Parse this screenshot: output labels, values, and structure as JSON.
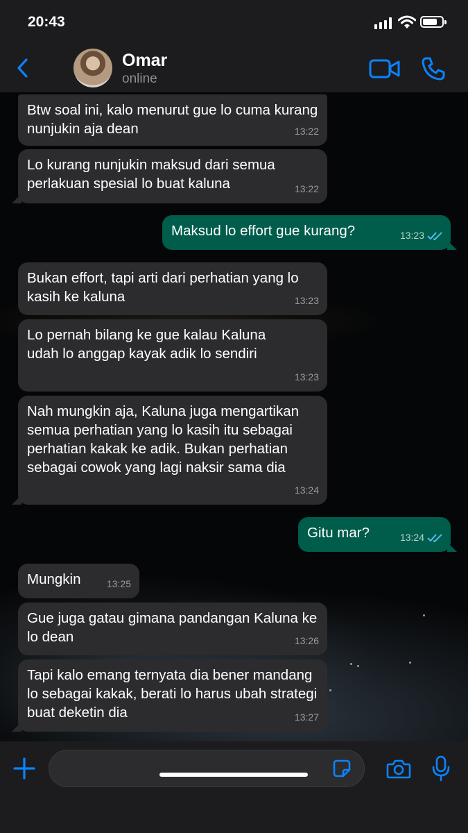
{
  "status_bar": {
    "time": "20:43"
  },
  "header": {
    "contact_name": "Omar",
    "contact_status": "online"
  },
  "colors": {
    "accent": "#0a84ff",
    "incoming_bubble": "#2c2c2e",
    "outgoing_bubble": "#005c4b",
    "read_ticks": "#53bdeb"
  },
  "messages": [
    {
      "direction": "in",
      "text": "Btw soal ini, kalo menurut gue lo cuma kurang nunjukin aja dean",
      "time": "13:22"
    },
    {
      "direction": "in",
      "text": "Lo kurang nunjukin maksud dari semua perlakuan spesial lo buat kaluna",
      "time": "13:22"
    },
    {
      "direction": "out",
      "text": "Maksud lo effort gue kurang?",
      "time": "13:23",
      "status": "read"
    },
    {
      "direction": "in",
      "text": "Bukan effort, tapi arti dari perhatian yang lo kasih ke kaluna",
      "time": "13:23"
    },
    {
      "direction": "in",
      "text": "Lo pernah bilang ke gue kalau Kaluna udah lo anggap kayak adik lo sendiri",
      "time": "13:23"
    },
    {
      "direction": "in",
      "text": "Nah mungkin aja, Kaluna juga mengartikan semua perhatian yang lo kasih itu sebagai perhatian kakak ke adik. Bukan perhatian sebagai cowok yang lagi naksir sama dia",
      "time": "13:24"
    },
    {
      "direction": "out",
      "text": "Gitu mar?",
      "time": "13:24",
      "status": "read"
    },
    {
      "direction": "in",
      "text": "Mungkin",
      "time": "13:25"
    },
    {
      "direction": "in",
      "text": "Gue juga gatau gimana pandangan Kaluna ke lo dean",
      "time": "13:26"
    },
    {
      "direction": "in",
      "text": "Tapi kalo emang ternyata dia bener mandang lo sebagai kakak, berati lo harus ubah strategi buat deketin dia",
      "time": "13:27"
    }
  ],
  "composer": {
    "value": "",
    "placeholder": ""
  },
  "icons": {
    "back": "chevron-left-icon",
    "video": "video-camera-icon",
    "call": "phone-icon",
    "plus": "plus-icon",
    "sticker": "sticker-icon",
    "camera": "camera-icon",
    "mic": "microphone-icon"
  }
}
